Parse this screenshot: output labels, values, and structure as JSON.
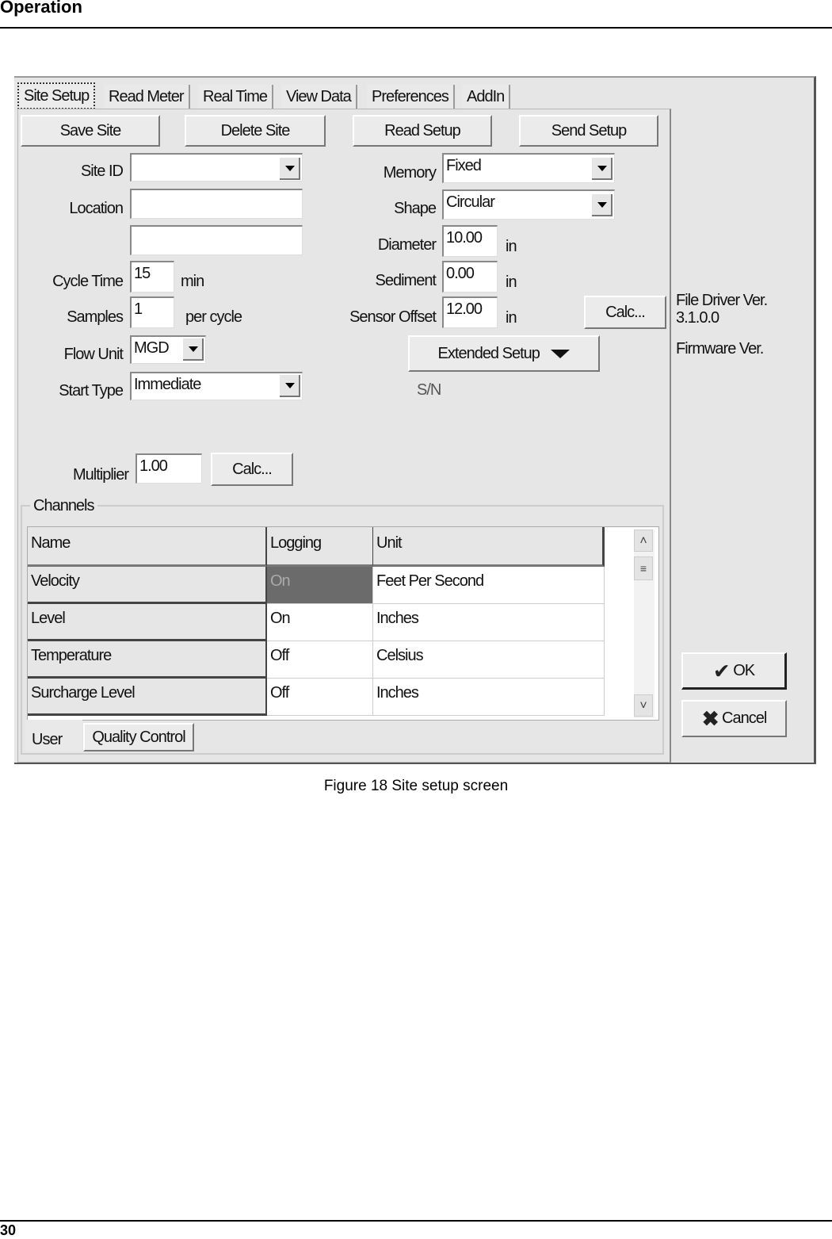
{
  "page": {
    "section_title": "Operation",
    "page_number": "30",
    "figure_caption": "Figure 18  Site setup screen"
  },
  "tabs": [
    {
      "label": "Site Setup",
      "active": true
    },
    {
      "label": "Read Meter"
    },
    {
      "label": "Real Time"
    },
    {
      "label": "View Data"
    },
    {
      "label": "Preferences"
    },
    {
      "label": "AddIn"
    }
  ],
  "toolbar": {
    "save_site": "Save Site",
    "delete_site": "Delete Site",
    "read_setup": "Read Setup",
    "send_setup": "Send Setup"
  },
  "left_form": {
    "site_id": {
      "label": "Site ID",
      "value": ""
    },
    "location": {
      "label": "Location",
      "value1": "",
      "value2": ""
    },
    "cycle_time": {
      "label": "Cycle Time",
      "value": "15",
      "unit": "min"
    },
    "samples": {
      "label": "Samples",
      "value": "1",
      "unit": "per cycle"
    },
    "flow_unit": {
      "label": "Flow Unit",
      "value": "MGD"
    },
    "start_type": {
      "label": "Start Type",
      "value": "Immediate"
    },
    "multiplier": {
      "label": "Multiplier",
      "value": "1.00",
      "calc": "Calc..."
    }
  },
  "right_form": {
    "memory": {
      "label": "Memory",
      "value": "Fixed"
    },
    "shape": {
      "label": "Shape",
      "value": "Circular"
    },
    "diameter": {
      "label": "Diameter",
      "value": "10.00",
      "unit": "in"
    },
    "sediment": {
      "label": "Sediment",
      "value": "0.00",
      "unit": "in"
    },
    "sensor_offset": {
      "label": "Sensor Offset",
      "value": "12.00",
      "unit": "in",
      "calc": "Calc..."
    },
    "extended_setup": "Extended Setup",
    "serial": "S/N"
  },
  "info": {
    "file_driver_label": "File Driver Ver.",
    "file_driver_value": "3.1.0.0",
    "firmware_label": "Firmware Ver."
  },
  "channels": {
    "title": "Channels",
    "columns": [
      "Name",
      "Logging",
      "Unit"
    ],
    "rows": [
      {
        "name": "Velocity",
        "logging": "On",
        "unit": "Feet Per Second",
        "selected": true
      },
      {
        "name": "Level",
        "logging": "On",
        "unit": "Inches"
      },
      {
        "name": "Temperature",
        "logging": "Off",
        "unit": "Celsius"
      },
      {
        "name": "Surcharge Level",
        "logging": "Off",
        "unit": "Inches"
      }
    ],
    "subtabs": [
      {
        "label": "User",
        "active": true
      },
      {
        "label": "Quality Control"
      }
    ]
  },
  "dialog": {
    "ok": "OK",
    "cancel": "Cancel"
  }
}
